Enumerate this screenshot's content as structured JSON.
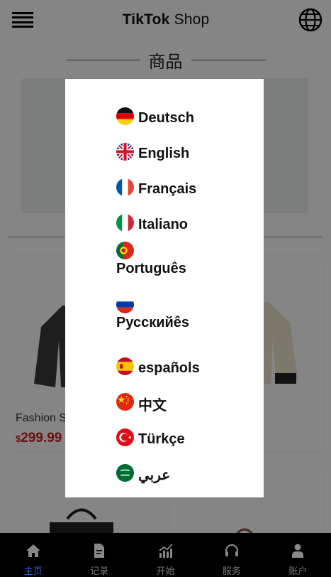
{
  "header": {
    "logo_part1": "TikTok",
    "logo_part2": " Shop"
  },
  "section": {
    "title": "商品"
  },
  "products": [
    {
      "name": "Fashion S",
      "currency": "$",
      "price": "299.99"
    }
  ],
  "languages": [
    {
      "label": "Deutsch",
      "flag": "de-flag-icon"
    },
    {
      "label": "English",
      "flag": "gb-flag-icon"
    },
    {
      "label": "Français",
      "flag": "fr-flag-icon"
    },
    {
      "label": "Italiano",
      "flag": "it-flag-icon"
    },
    {
      "label": "Português",
      "flag": "pt-flag-icon"
    },
    {
      "label": "Русскийês",
      "flag": "ru-flag-icon"
    },
    {
      "label": "españols",
      "flag": "es-flag-icon"
    },
    {
      "label": "中文",
      "flag": "cn-flag-icon"
    },
    {
      "label": "Türkçe",
      "flag": "tr-flag-icon"
    },
    {
      "label": "عربي",
      "flag": "sa-flag-icon"
    }
  ],
  "bottom_nav": [
    {
      "label": "主页",
      "icon": "home-icon",
      "active": true
    },
    {
      "label": "记录",
      "icon": "document-icon",
      "active": false
    },
    {
      "label": "开始",
      "icon": "chart-icon",
      "active": false
    },
    {
      "label": "服务",
      "icon": "headset-icon",
      "active": false
    },
    {
      "label": "账户",
      "icon": "user-icon",
      "active": false
    }
  ],
  "colors": {
    "price": "#cc1f1f",
    "nav_active": "#2f63c8",
    "nav_background": "#000000",
    "overlay": "rgba(0,0,0,0.48)"
  }
}
